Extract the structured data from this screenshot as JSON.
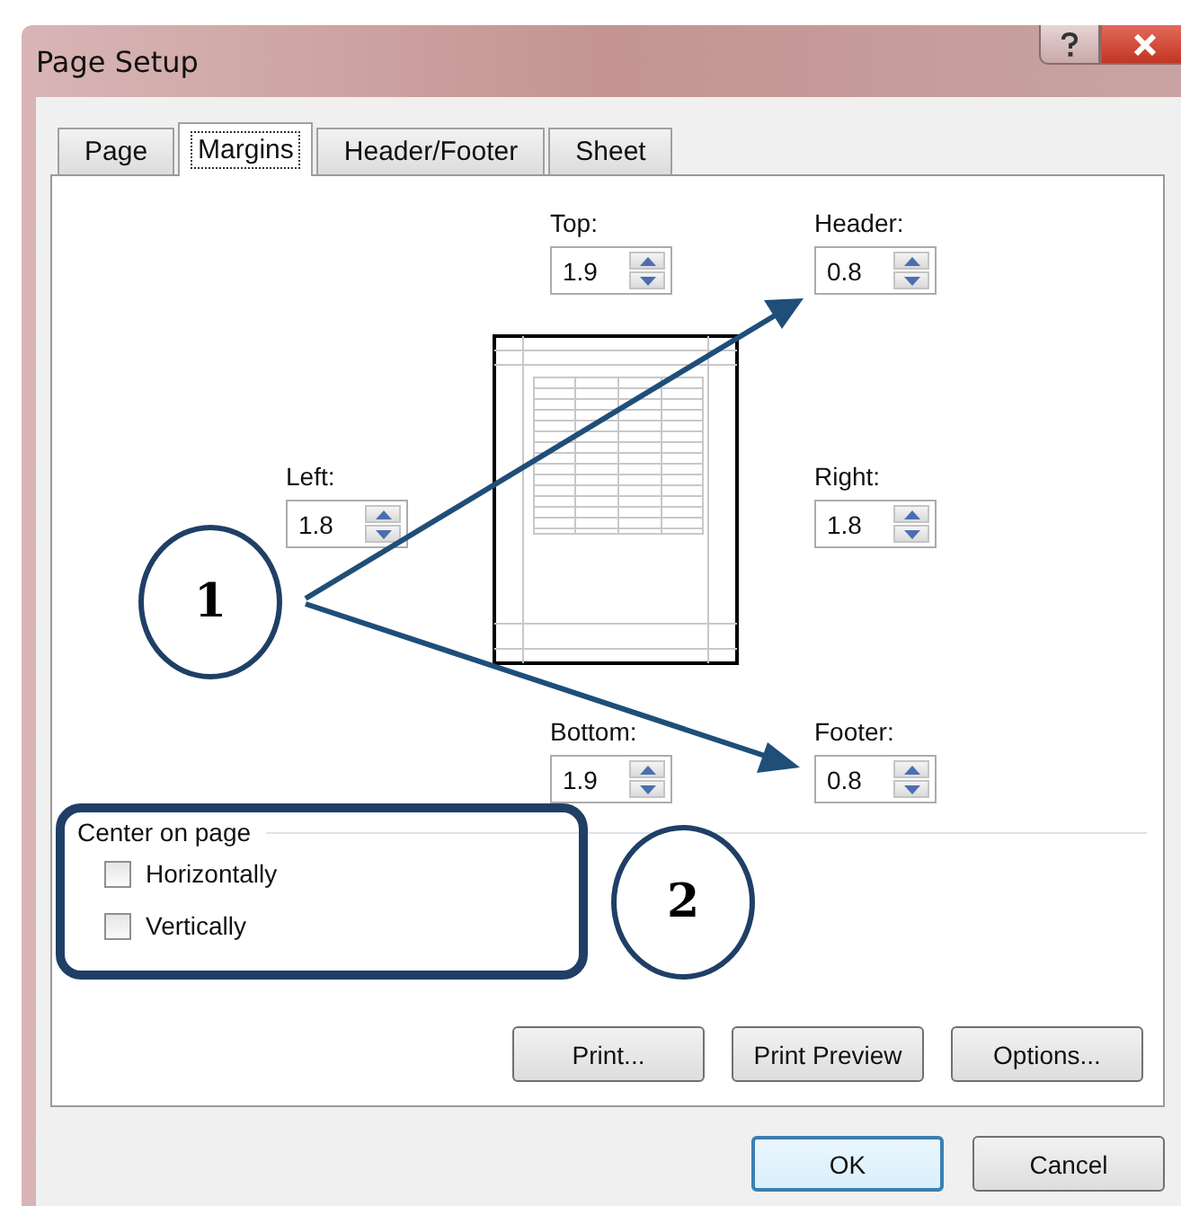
{
  "window": {
    "title": "Page Setup"
  },
  "tabs": [
    {
      "label": "Page",
      "selected": false
    },
    {
      "label": "Margins",
      "selected": true
    },
    {
      "label": "Header/Footer",
      "selected": false
    },
    {
      "label": "Sheet",
      "selected": false
    }
  ],
  "margins": {
    "top": {
      "label": "Top:",
      "value": "1.9"
    },
    "header": {
      "label": "Header:",
      "value": "0.8"
    },
    "left": {
      "label": "Left:",
      "value": "1.8"
    },
    "right": {
      "label": "Right:",
      "value": "1.8"
    },
    "bottom": {
      "label": "Bottom:",
      "value": "1.9"
    },
    "footer": {
      "label": "Footer:",
      "value": "0.8"
    }
  },
  "center_on_page": {
    "title": "Center on page",
    "options": [
      {
        "label": "Horizontally",
        "checked": false
      },
      {
        "label": "Vertically",
        "checked": false
      }
    ]
  },
  "panel_buttons": [
    "Print...",
    "Print Preview",
    "Options..."
  ],
  "dialog_buttons": [
    {
      "label": "OK",
      "default": true
    },
    {
      "label": "Cancel",
      "default": false
    }
  ],
  "callouts": [
    {
      "label": "1"
    },
    {
      "label": "2"
    }
  ]
}
